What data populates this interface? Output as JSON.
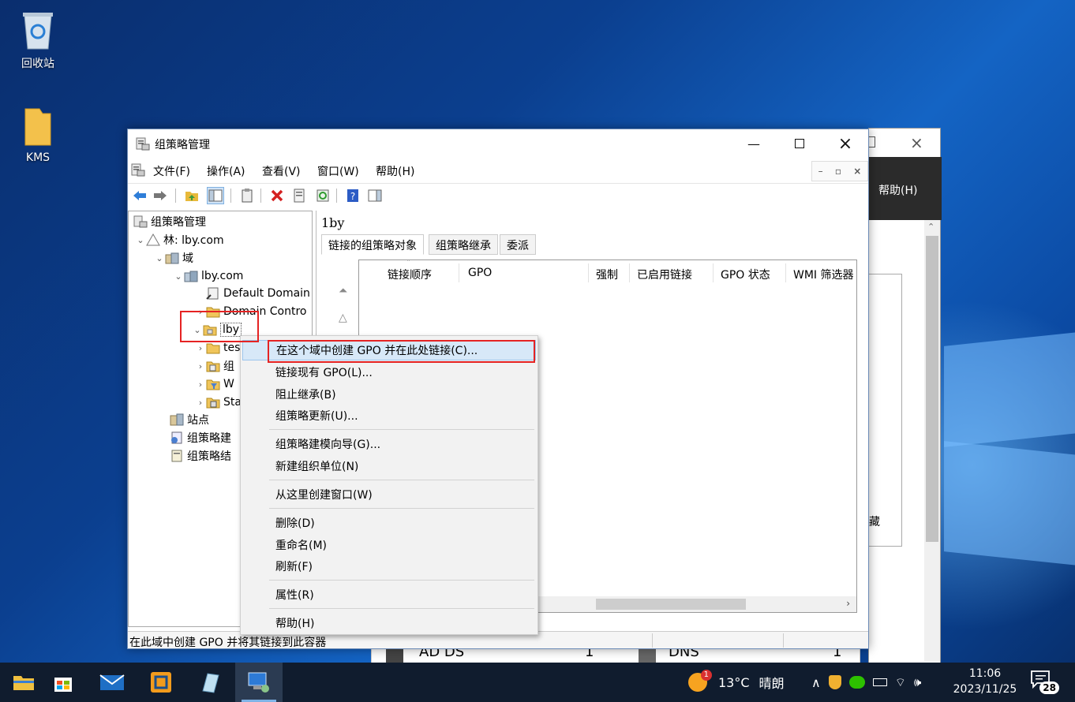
{
  "desktop": {
    "icons": [
      {
        "label": "回收站"
      },
      {
        "label": "KMS"
      }
    ]
  },
  "bg_window": {
    "help_label": "帮助(H)",
    "side_char": "藏",
    "strip_left": "AD DS",
    "strip_left_count": "1",
    "strip_right": "DNS",
    "strip_right_count": "1"
  },
  "window": {
    "title": "组策略管理",
    "menu": [
      "文件(F)",
      "操作(A)",
      "查看(V)",
      "窗口(W)",
      "帮助(H)"
    ]
  },
  "tree": {
    "root": "组策略管理",
    "forest": "林: lby.com",
    "domains": "域",
    "domain": "lby.com",
    "default_domain": "Default Domain",
    "domain_controllers": "Domain Contro",
    "ou_lby": "lby",
    "child_1": "tes",
    "child_2": "组",
    "child_3": "W",
    "child_4": "Sta",
    "sites": "站点",
    "modeling": "组策略建",
    "results": "组策略结"
  },
  "right": {
    "title": "1by",
    "tabs": [
      "链接的组策略对象",
      "组策略继承",
      "委派"
    ],
    "columns": [
      "链接顺序",
      "GPO",
      "强制",
      "已启用链接",
      "GPO 状态",
      "WMI 筛选器"
    ]
  },
  "context_menu": {
    "items": [
      "在这个域中创建 GPO 并在此处链接(C)...",
      "链接现有 GPO(L)...",
      "阻止继承(B)",
      "组策略更新(U)...",
      "组策略建模向导(G)...",
      "新建组织单位(N)",
      "从这里创建窗口(W)",
      "删除(D)",
      "重命名(M)",
      "刷新(F)",
      "属性(R)",
      "帮助(H)"
    ]
  },
  "status": {
    "text": "在此域中创建 GPO 并将其链接到此容器"
  },
  "taskbar": {
    "weather_temp": "13°C",
    "weather_desc": "晴朗",
    "weather_badge": "1",
    "time": "11:06",
    "date": "2023/11/25",
    "notifications": "28"
  }
}
